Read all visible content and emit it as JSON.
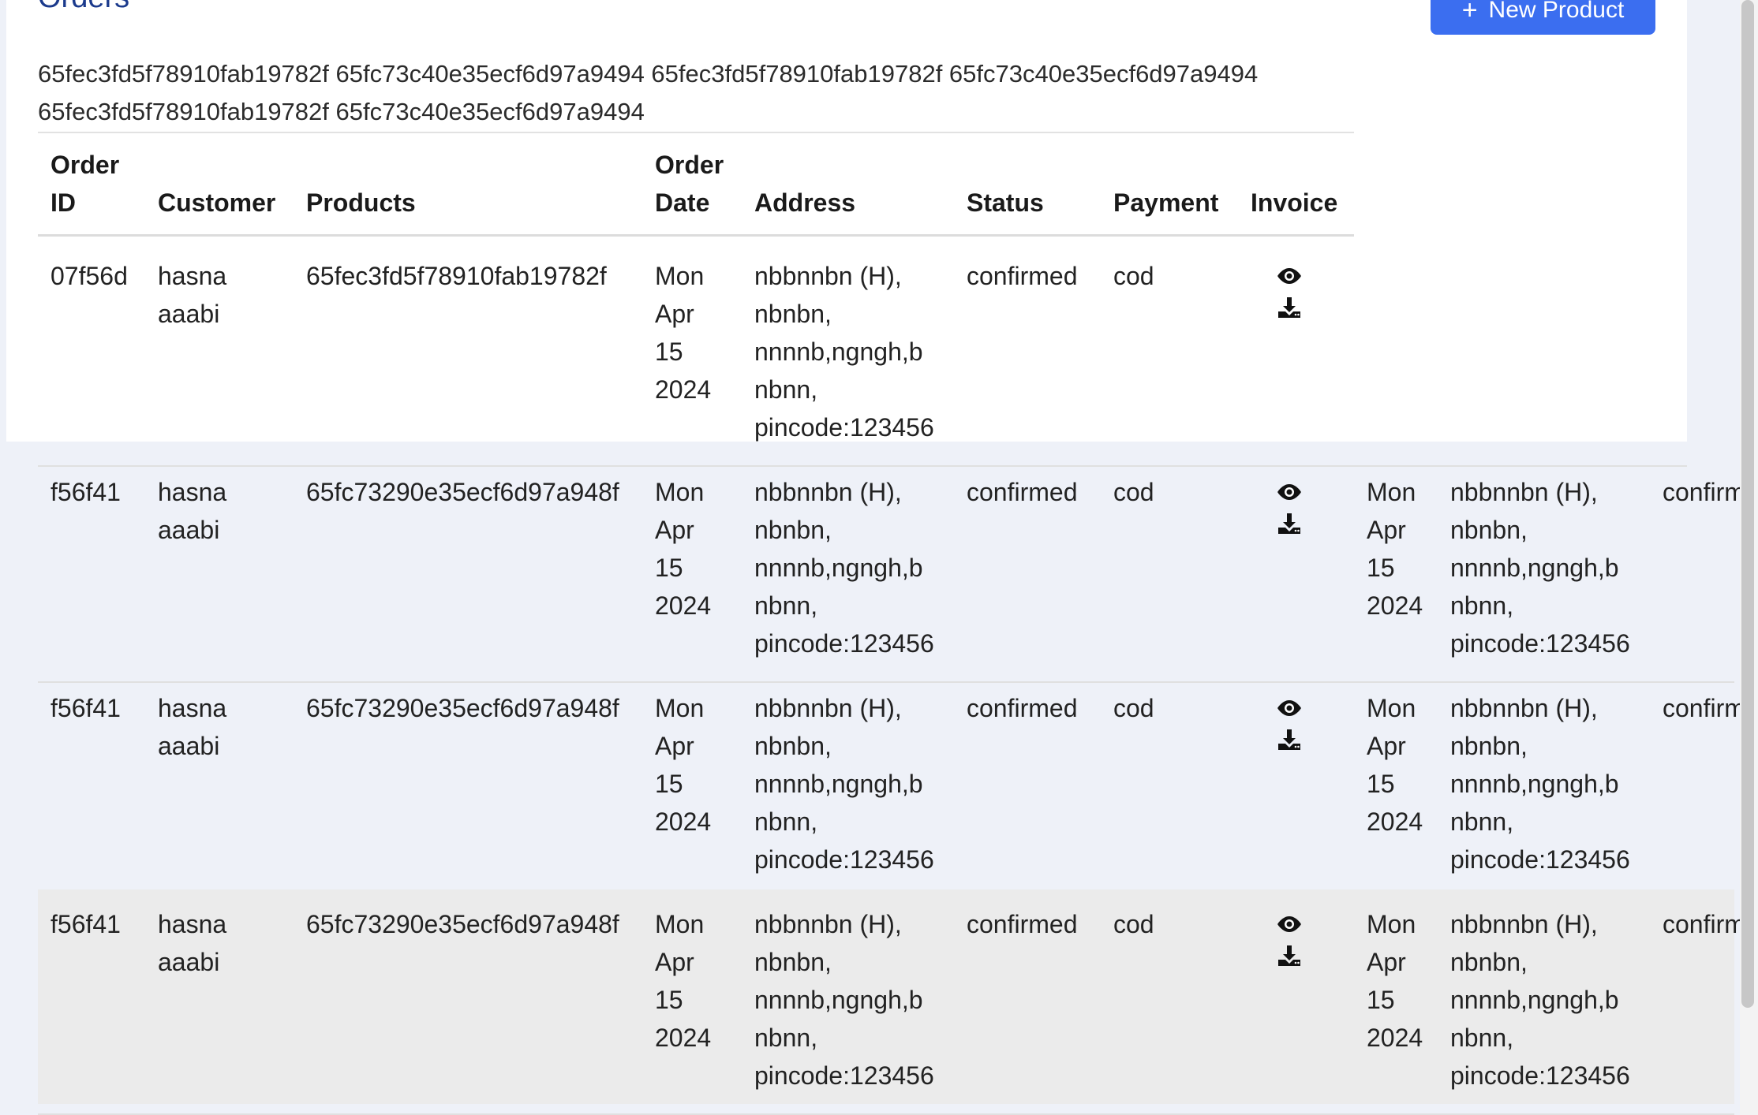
{
  "header": {
    "title": "Orders",
    "new_button_label": "New Product",
    "new_button_icon": "plus-icon"
  },
  "product_ids_line1": "65fec3fd5f78910fab19782f 65fc73c40e35ecf6d97a9494 65fec3fd5f78910fab19782f 65fc73c40e35ecf6d97a9494",
  "product_ids_line2": "65fec3fd5f78910fab19782f 65fc73c40e35ecf6d97a9494",
  "table": {
    "headers": {
      "order_id_1": "Order",
      "order_id_2": "ID",
      "customer": "Customer",
      "products": "Products",
      "order_date_1": "Order",
      "order_date_2": "Date",
      "address": "Address",
      "status": "Status",
      "payment": "Payment",
      "invoice": "Invoice"
    },
    "rows": [
      {
        "order_id": "07f56d",
        "customer": [
          "hasna",
          "aaabi"
        ],
        "product": "65fec3fd5f78910fab19782f",
        "date": [
          "Mon",
          "Apr",
          "15",
          "2024"
        ],
        "address": [
          "nbbnnbn (H),",
          "nbnbn,",
          "nnnnb,ngngh,b",
          "nbnn,",
          "pincode:123456"
        ],
        "status": "confirmed",
        "payment": "cod",
        "overflow": null
      },
      {
        "order_id": "f56f41",
        "customer": [
          "hasna",
          "aaabi"
        ],
        "product": "65fc73290e35ecf6d97a948f",
        "date": [
          "Mon",
          "Apr",
          "15",
          "2024"
        ],
        "address": [
          "nbbnnbn (H),",
          "nbnbn,",
          "nnnnb,ngngh,b",
          "nbnn,",
          "pincode:123456"
        ],
        "status": "confirmed",
        "payment": "cod",
        "overflow": {
          "date": [
            "Mon",
            "Apr",
            "15",
            "2024"
          ],
          "address": [
            "nbbnnbn (H),",
            "nbnbn,",
            "nnnnb,ngngh,b",
            "nbnn,",
            "pincode:123456"
          ],
          "status": "confirmed"
        }
      },
      {
        "order_id": "f56f41",
        "customer": [
          "hasna",
          "aaabi"
        ],
        "product": "65fc73290e35ecf6d97a948f",
        "date": [
          "Mon",
          "Apr",
          "15",
          "2024"
        ],
        "address": [
          "nbbnnbn (H),",
          "nbnbn,",
          "nnnnb,ngngh,b",
          "nbnn,",
          "pincode:123456"
        ],
        "status": "confirmed",
        "payment": "cod",
        "overflow": {
          "date": [
            "Mon",
            "Apr",
            "15",
            "2024"
          ],
          "address": [
            "nbbnnbn (H),",
            "nbnbn,",
            "nnnnb,ngngh,b",
            "nbnn,",
            "pincode:123456"
          ],
          "status": "confirmed"
        }
      },
      {
        "order_id": "f56f41",
        "customer": [
          "hasna",
          "aaabi"
        ],
        "product": "65fc73290e35ecf6d97a948f",
        "date": [
          "Mon",
          "Apr",
          "15",
          "2024"
        ],
        "address": [
          "nbbnnbn (H),",
          "nbnbn,",
          "nnnnb,ngngh,b",
          "nbnn,",
          "pincode:123456"
        ],
        "status": "confirmed",
        "payment": "cod",
        "highlighted": true,
        "overflow": {
          "date": [
            "Mon",
            "Apr",
            "15",
            "2024"
          ],
          "address": [
            "nbbnnbn (H),",
            "nbnbn,",
            "nnnnb,ngngh,b",
            "nbnn,",
            "pincode:123456"
          ],
          "status": "confirmed"
        }
      }
    ]
  },
  "colors": {
    "title": "#1b3a8c",
    "button": "#3b6ef0",
    "row_highlight": "#ebebeb",
    "page_bg": "#eef1f8"
  },
  "icons": {
    "view": "eye-icon",
    "download": "download-icon"
  }
}
